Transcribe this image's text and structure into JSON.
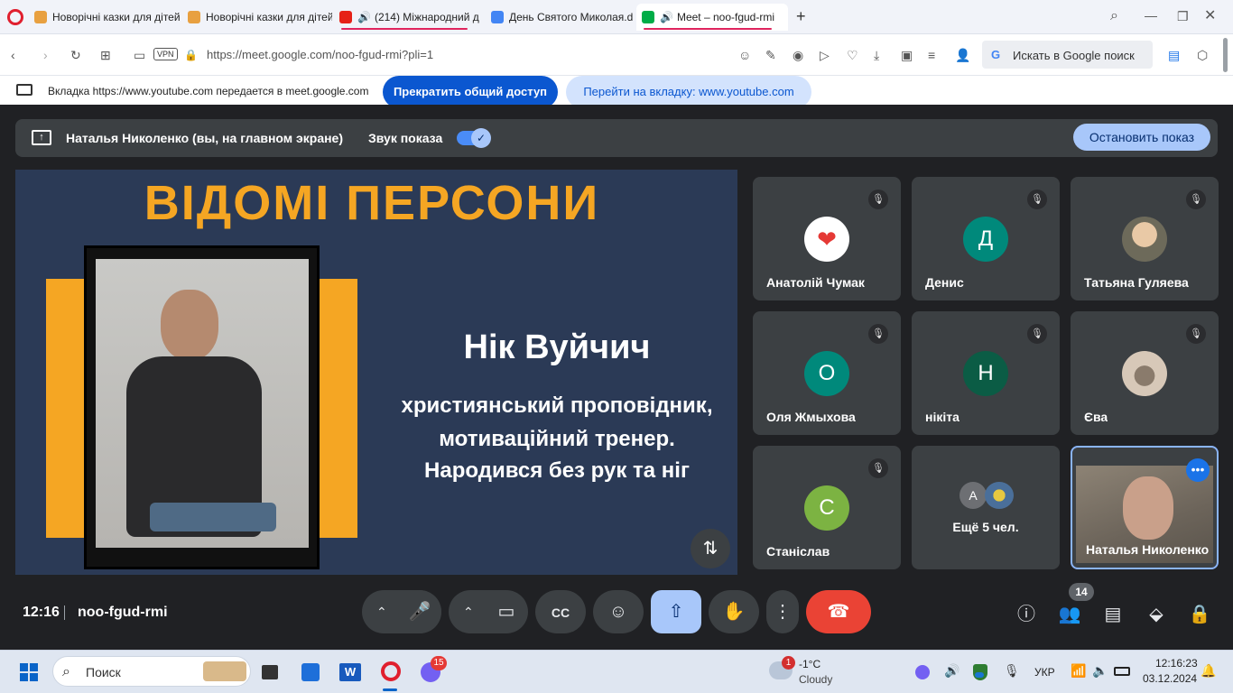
{
  "tabs": [
    {
      "title": "Новорічні казки для дітей",
      "color": "#e8a040"
    },
    {
      "title": "Новорічні казки для дітей",
      "color": "#e8a040"
    },
    {
      "title": "(214) Міжнародний д",
      "color": "#e62117"
    },
    {
      "title": "День Святого Миколая.d",
      "color": "#4285f4"
    },
    {
      "title": "Meet – noo-fgud-rmi",
      "color": "#00ac47"
    }
  ],
  "address": {
    "vpn": "VPN",
    "url": "https://meet.google.com/noo-fgud-rmi?pli=1",
    "search_placeholder": "Искать в Google поиск"
  },
  "sharebar": {
    "message": "Вкладка https://www.youtube.com передается в meet.google.com",
    "stop_label": "Прекратить общий доступ",
    "goto_label": "Перейти на вкладку: www.youtube.com"
  },
  "banner": {
    "presenter": "Наталья Николенко (вы, на главном экране)",
    "sound_label": "Звук показа",
    "stop_label": "Остановить показ"
  },
  "slide": {
    "heading": "ВІДОМІ ПЕРСОНИ",
    "name": "Нік Вуйчич",
    "line1": "християнський проповідник,",
    "line2": "мотиваційний тренер.",
    "line3": "Народився без рук та ніг"
  },
  "participants": [
    {
      "name": "Анатолій Чумак",
      "avatar": "",
      "color": "#ffffff"
    },
    {
      "name": "Денис",
      "avatar": "Д",
      "color": "#00897b"
    },
    {
      "name": "Татьяна Гуляева",
      "avatar": "",
      "color": "#c9a882"
    },
    {
      "name": "Оля Жмыхова",
      "avatar": "О",
      "color": "#00897b"
    },
    {
      "name": "нікіта",
      "avatar": "Н",
      "color": "#0b5c45"
    },
    {
      "name": "Єва",
      "avatar": "",
      "color": "#d7c8b8"
    },
    {
      "name": "Станіслав",
      "avatar": "С",
      "color": "#7cb342"
    }
  ],
  "more": {
    "label": "Ещё 5 чел.",
    "avatar": "А"
  },
  "self": {
    "name": "Наталья Николенко"
  },
  "bottom": {
    "time": "12:16",
    "code": "noo-fgud-rmi",
    "people_count": "14"
  },
  "taskbar": {
    "search": "Поиск",
    "viber_badge": "15",
    "weather_badge": "1",
    "temp": "-1°C",
    "weather": "Cloudy",
    "lang": "УКР",
    "time": "12:16:23",
    "date": "03.12.2024"
  }
}
